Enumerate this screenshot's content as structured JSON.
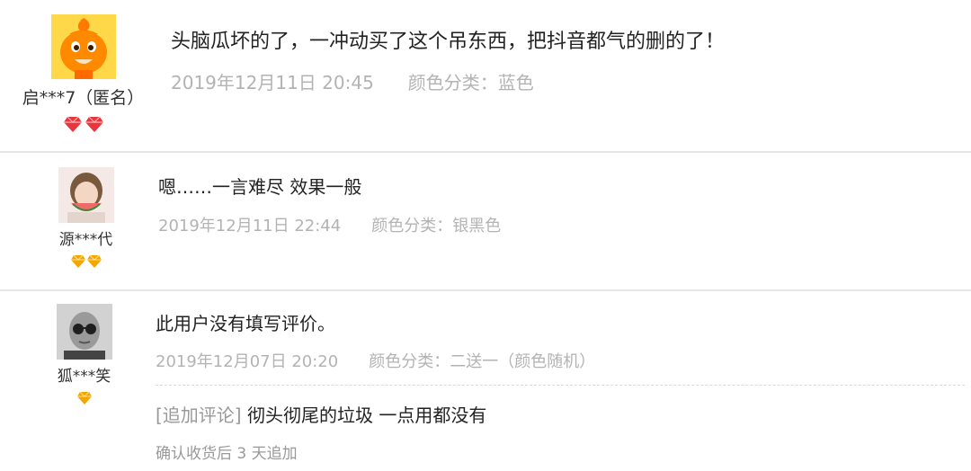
{
  "reviews": [
    {
      "username": "启***7（匿名）",
      "content": "头脑瓜坏的了，一冲动买了这个吊东西，把抖音都气的删的了！",
      "date": "2019年12月11日 20:45",
      "spec": "颜色分类：蓝色",
      "avatar_icon": "orange-mascot-avatar",
      "badge_icon": "red-heart-diamond-icon",
      "badge_count": 2
    },
    {
      "username": "源***代",
      "content": "嗯……一言难尽 效果一般",
      "date": "2019年12月11日 22:44",
      "spec": "颜色分类：银黑色",
      "avatar_icon": "girl-with-watermelon-avatar",
      "badge_icon": "gold-diamond-icon",
      "badge_count": 2
    },
    {
      "username": "狐***笑",
      "content": "此用户没有填写评价。",
      "date": "2019年12月07日 20:20",
      "spec": "颜色分类：二送一（颜色随机）",
      "append_tag": "[追加评论]",
      "append_text": "彻头彻尾的垃圾 一点用都没有",
      "append_note": "确认收货后 3 天追加",
      "avatar_icon": "man-with-sunglasses-avatar",
      "badge_icon": "gold-diamond-icon",
      "badge_count": 1
    }
  ],
  "colors": {
    "text": "#333333",
    "meta": "#b3b3b3",
    "divider": "#e6e6e6",
    "heart_badge": "#e8363c",
    "gold_badge": "#f5a500",
    "avatar_orange": "#ff8a00"
  }
}
